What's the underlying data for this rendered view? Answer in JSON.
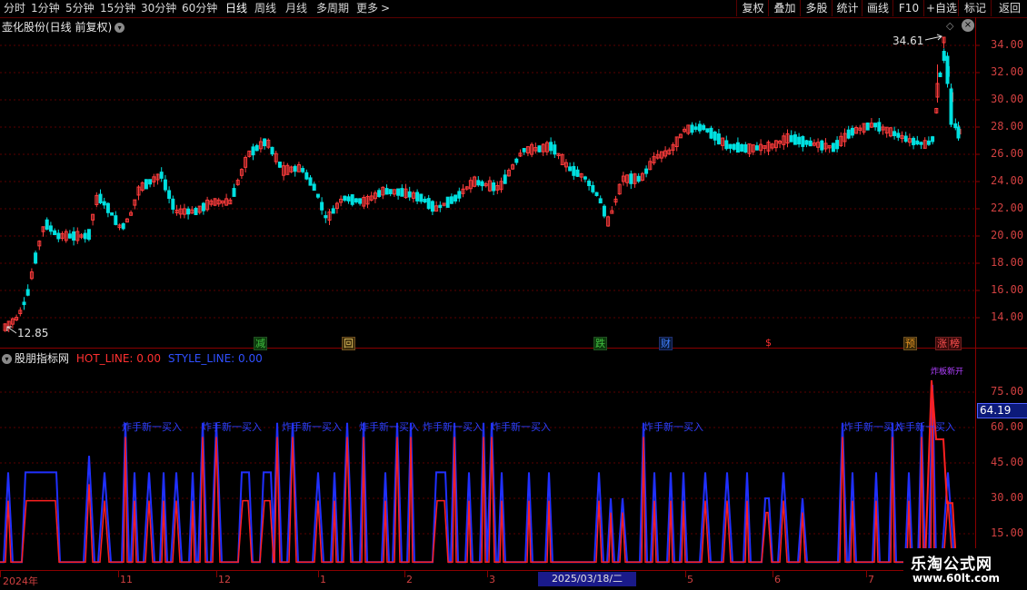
{
  "toolbar": {
    "periods": [
      {
        "label": "分时"
      },
      {
        "label": "1分钟"
      },
      {
        "label": "5分钟"
      },
      {
        "label": "15分钟"
      },
      {
        "label": "30分钟"
      },
      {
        "label": "60分钟"
      },
      {
        "label": "日线"
      },
      {
        "label": "周线"
      },
      {
        "label": "月线"
      },
      {
        "label": "多周期"
      },
      {
        "label": "更多"
      }
    ],
    "more_arrow": ">",
    "right": [
      {
        "label": "复权"
      },
      {
        "label": "叠加"
      },
      {
        "label": "多股"
      },
      {
        "label": "统计"
      },
      {
        "label": "画线"
      },
      {
        "label": "F10"
      },
      {
        "label": "+自选"
      },
      {
        "label": "标记"
      },
      {
        "label": "返回"
      }
    ]
  },
  "main_chart": {
    "title": "壶化股份(日线 前复权)",
    "high_label": "34.61",
    "low_label": "12.85",
    "price_axis": [
      "34.00",
      "32.00",
      "30.00",
      "28.00",
      "26.00",
      "24.00",
      "22.00",
      "20.00",
      "18.00",
      "16.00",
      "14.00"
    ],
    "events": [
      {
        "text": "减",
        "color": "#40c040"
      },
      {
        "text": "回",
        "color": "#e0c060"
      },
      {
        "text": "跌",
        "color": "#40c040"
      },
      {
        "text": "财",
        "color": "#4080ff"
      },
      {
        "text": "$",
        "color": "#ff3030"
      },
      {
        "text": "预",
        "color": "#e09020"
      },
      {
        "text": "涨",
        "color": "#ff5050"
      },
      {
        "text": "榜",
        "color": "#ff5050"
      }
    ]
  },
  "indicator": {
    "name": "股朋指标网",
    "hot_line": "HOT_LINE: 0.00",
    "style_line": "STYLE_LINE: 0.00",
    "axis": [
      "75.00",
      "60.00",
      "45.00",
      "30.00",
      "15.00"
    ],
    "current_value": "64.19",
    "signal_text": "炸手新一买入",
    "top_text": "炸板新开"
  },
  "x_axis": [
    "2024年",
    "11",
    "12",
    "1",
    "2",
    "3",
    "5",
    "6",
    "7"
  ],
  "cursor_date": "2025/03/18/二",
  "watermark": {
    "title": "乐淘公式网",
    "url": "www.60lt.com"
  },
  "colors": {
    "up": "#ff3c3c",
    "down": "#00e0e0",
    "hot": "#ff2020",
    "style": "#2030ff",
    "grid": "#5a0000"
  },
  "chart_data": {
    "type": "candlestick",
    "price_axis_range": [
      12.85,
      34.61
    ],
    "indicator_axis_range": [
      0,
      75
    ],
    "high": 34.61,
    "low": 12.85
  }
}
